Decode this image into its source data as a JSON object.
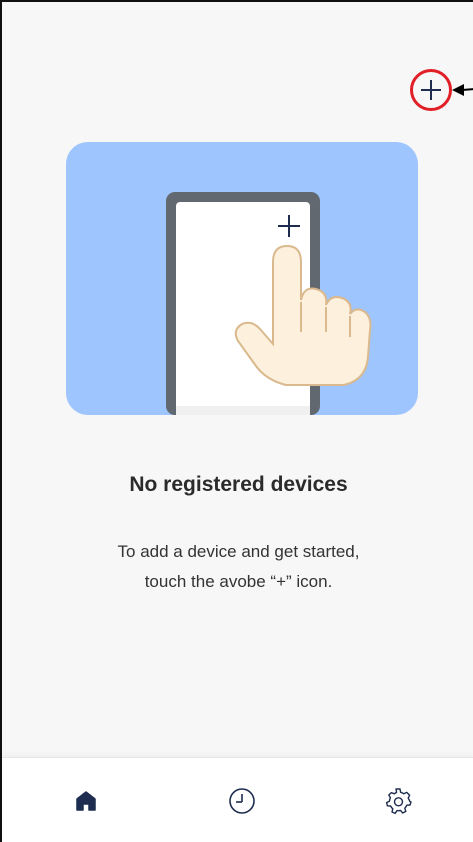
{
  "header": {
    "add_icon": "plus-icon"
  },
  "empty_state": {
    "title": "No registered devices",
    "description_line1": "To add a device and get started,",
    "description_line2": "touch the avobe “+” icon.",
    "illustration": "hand-tapping-phone-plus-illustration"
  },
  "bottom_nav": {
    "items": [
      {
        "name": "home",
        "icon": "home-icon",
        "active": true
      },
      {
        "name": "history",
        "icon": "clock-icon",
        "active": false
      },
      {
        "name": "settings",
        "icon": "gear-icon",
        "active": false
      }
    ]
  },
  "colors": {
    "background": "#f7f7f7",
    "illustration_bg": "#9fc5ff",
    "phone_frame": "#616870",
    "hand_fill": "#fdf0dc",
    "hand_stroke": "#d9b98d",
    "accent_dark": "#1d2c4f",
    "highlight_red": "#e01f26"
  }
}
